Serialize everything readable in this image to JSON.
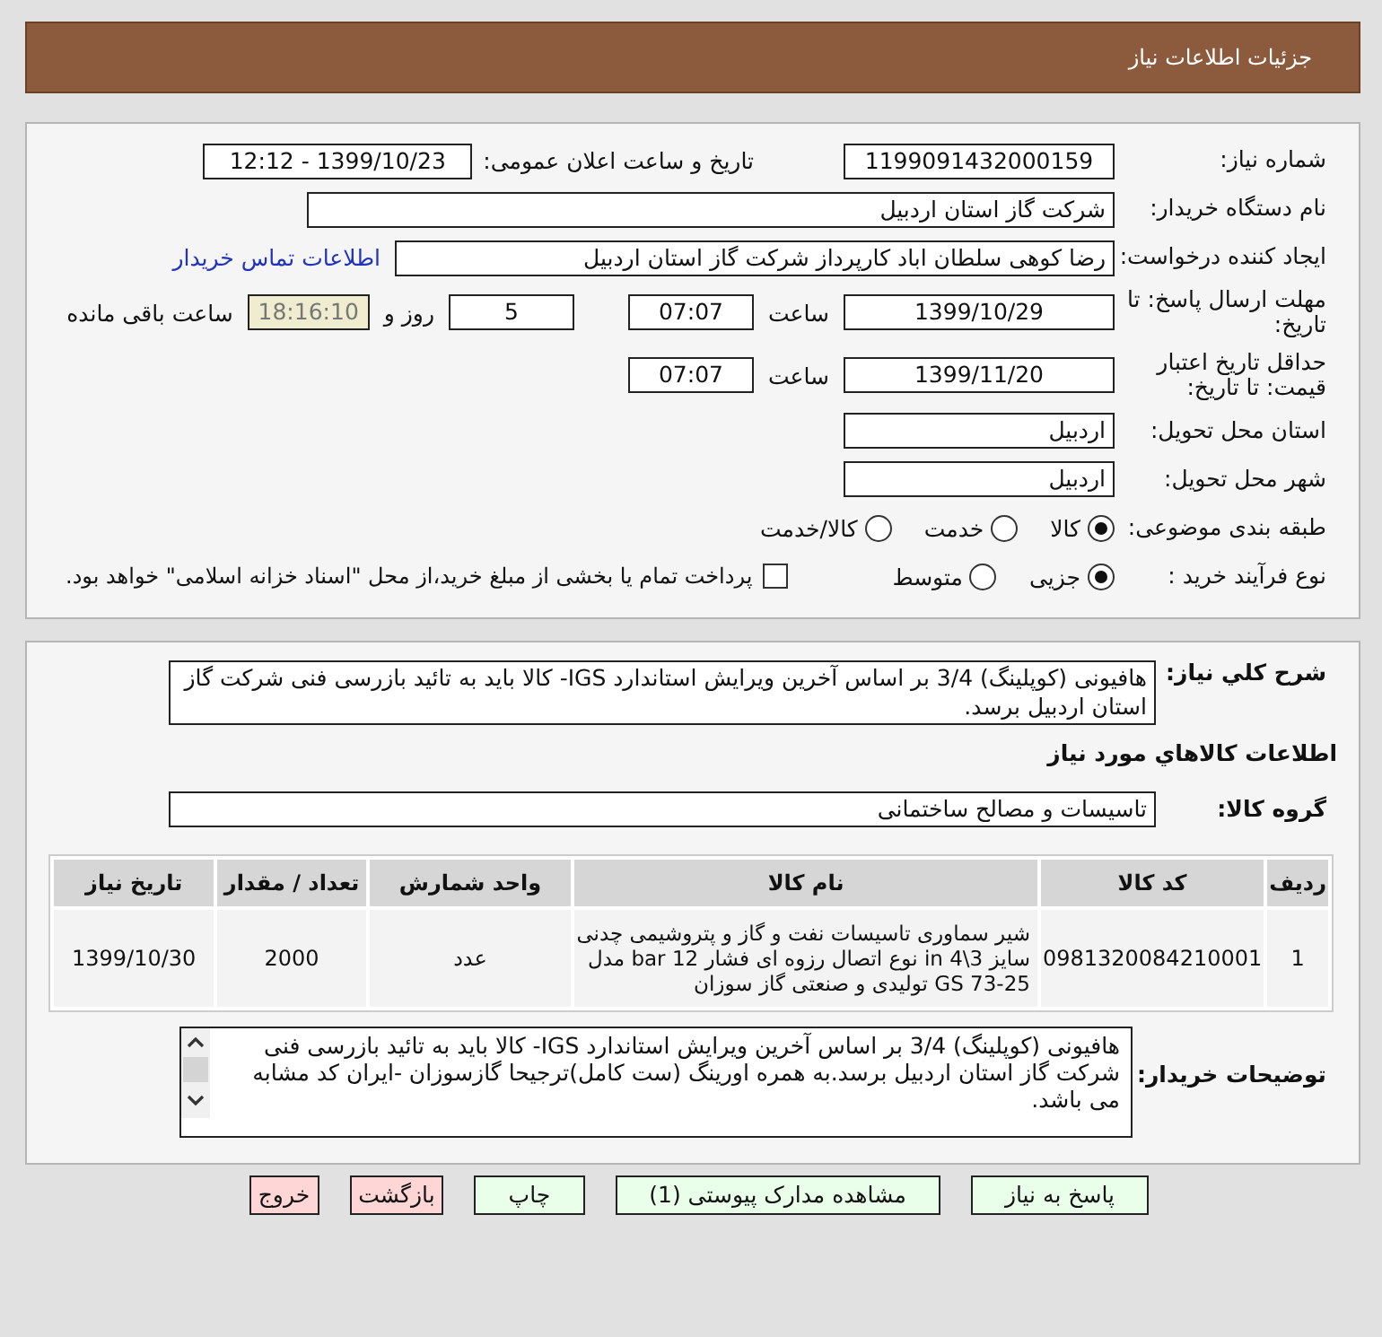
{
  "header": {
    "title": "جزئیات اطلاعات نیاز"
  },
  "need_number": {
    "label": "شماره نیاز:",
    "value": "1199091432000159"
  },
  "announce": {
    "label": "تاریخ و ساعت اعلان عمومی:",
    "value": "1399/10/23 - 12:12"
  },
  "buyer_org": {
    "label": "نام دستگاه خریدار:",
    "value": "شرکت گاز استان اردبیل"
  },
  "requester": {
    "label": "ایجاد کننده درخواست:",
    "value": "رضا کوهی سلطان اباد کارپرداز شرکت گاز استان اردبیل",
    "link": "اطلاعات تماس خریدار"
  },
  "deadline": {
    "label": "مهلت ارسال پاسخ: تا تاریخ:",
    "date": "1399/10/29",
    "time_label": "ساعت",
    "time": "07:07",
    "days": "5",
    "days_label": "روز و",
    "remaining": "18:16:10",
    "remaining_label": "ساعت باقی مانده"
  },
  "validity": {
    "label": "حداقل تاریخ اعتبار قیمت: تا تاریخ:",
    "date": "1399/11/20",
    "time_label": "ساعت",
    "time": "07:07"
  },
  "province": {
    "label": "استان محل تحویل:",
    "value": "اردبیل"
  },
  "city": {
    "label": "شهر محل تحویل:",
    "value": "اردبیل"
  },
  "category": {
    "label": "طبقه بندی موضوعی:",
    "options": [
      {
        "label": "کالا",
        "selected": true
      },
      {
        "label": "خدمت",
        "selected": false
      },
      {
        "label": "کالا/خدمت",
        "selected": false
      }
    ]
  },
  "process": {
    "label": "نوع فرآیند خرید :",
    "options": [
      {
        "label": "جزیی",
        "selected": true
      },
      {
        "label": "متوسط",
        "selected": false
      }
    ],
    "payment": {
      "checked": false,
      "text": "پرداخت تمام یا بخشی از مبلغ خرید،از محل \"اسناد خزانه اسلامی\" خواهد بود."
    }
  },
  "description": {
    "label": "شرح کلي نياز:",
    "value": "هافیونی (کوپلینگ) 3/4 بر اساس آخرین ویرایش استاندارد IGS- کالا باید به تائید بازرسی فنی شرکت گاز استان اردبیل برسد."
  },
  "goods_heading": "اطلاعات کالاهاي مورد نياز",
  "goods_group": {
    "label": "گروه کالا:",
    "value": "تاسیسات و مصالح ساختمانی"
  },
  "table": {
    "columns": [
      "ردیف",
      "کد کالا",
      "نام کالا",
      "واحد شمارش",
      "تعداد / مقدار",
      "تاریخ نیاز"
    ],
    "rows": [
      [
        "1",
        "0981320084210001",
        "شیر سماوری تاسیسات نفت و گاز و پتروشیمی چدنی سایز 3\\4 in نوع اتصال رزوه ای فشار 12 bar مدل GS 73-25 تولیدی و صنعتی گاز سوزان",
        "عدد",
        "2000",
        "1399/10/30"
      ]
    ]
  },
  "buyer_notes": {
    "label": "توضیحات خریدار:",
    "value": "هافیونی (کوپلینگ) 3/4 بر اساس آخرین ویرایش استاندارد IGS- کالا باید به تائید بازرسی فنی شرکت گاز استان اردبیل برسد.به همره اورینگ (ست کامل)ترجیحا گازسوزان -ایران کد مشابه می باشد."
  },
  "buttons": [
    {
      "label": "پاسخ به نیاز",
      "kind": "normal"
    },
    {
      "label": "مشاهده مدارک پیوستی (1)",
      "kind": "normal"
    },
    {
      "label": "چاپ",
      "kind": "normal"
    },
    {
      "label": "بازگشت",
      "kind": "danger"
    },
    {
      "label": "خروج",
      "kind": "danger"
    }
  ]
}
